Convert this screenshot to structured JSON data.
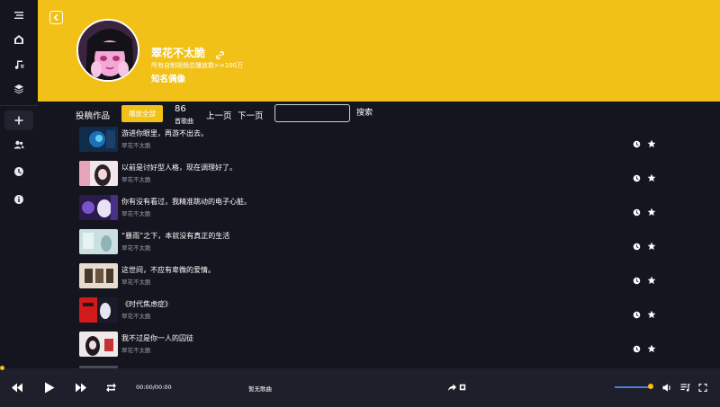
{
  "colors": {
    "accent": "#f2c118",
    "background": "#15151f",
    "player": "#1f1f2b",
    "volume": "#4b7cd8"
  },
  "sidebar": {
    "items": [
      {
        "name": "menu-icon"
      },
      {
        "name": "home-icon"
      },
      {
        "name": "music-note-icon"
      },
      {
        "name": "layers-icon"
      },
      {
        "name": "plus-icon"
      },
      {
        "name": "users-icon"
      },
      {
        "name": "clock-icon"
      },
      {
        "name": "info-icon"
      }
    ]
  },
  "artist": {
    "name": "翠花不太脆",
    "subtitle": "所有自制视频总播放数>=100万",
    "title": "知名偶像"
  },
  "toolbar": {
    "tab_label": "投稿作品",
    "play_all": "播放全部",
    "count": "86",
    "count_label": "首歌曲",
    "prev": "上一页",
    "next": "下一页",
    "search_value": "",
    "search": "搜索"
  },
  "songs": [
    {
      "title": "游进你眼里，再游不出去。",
      "artist": "翠花不太脆"
    },
    {
      "title": "以前是讨好型人格，现在调理好了。",
      "artist": "翠花不太脆"
    },
    {
      "title": "你有没有看过，我精准跳动的电子心脏。",
      "artist": "翠花不太脆"
    },
    {
      "title": "“暴雨”之下，本就没有真正的生活",
      "artist": "翠花不太脆"
    },
    {
      "title": "这世间，不应有卑微的爱情。",
      "artist": "翠花不太脆"
    },
    {
      "title": "《时代焦虑症》",
      "artist": "翠花不太脆"
    },
    {
      "title": "我不过是你一人的囚徒",
      "artist": "翠花不太脆"
    }
  ],
  "player": {
    "time": "00:00/00:00",
    "now_playing": "暂无歌曲",
    "progress": 0,
    "volume": 0.95
  }
}
